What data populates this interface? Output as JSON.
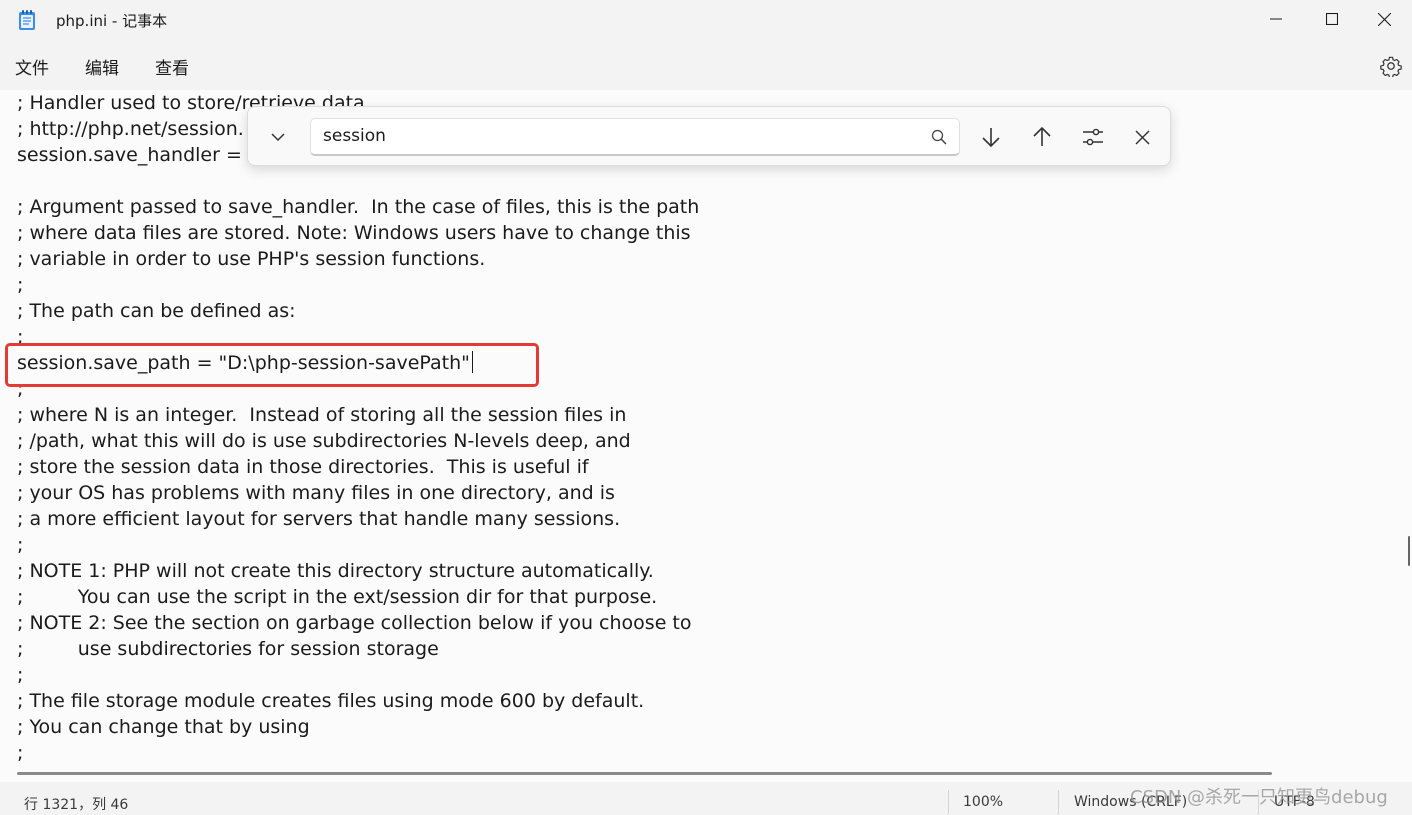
{
  "window": {
    "title": "php.ini - 记事本"
  },
  "menu": {
    "items": [
      "文件",
      "编辑",
      "查看"
    ]
  },
  "editor": {
    "lines": [
      "; Handler used to store/retrieve data.",
      "; http://php.net/session.",
      "session.save_handler = f",
      "",
      "; Argument passed to save_handler.  In the case of files, this is the path",
      "; where data files are stored. Note: Windows users have to change this",
      "; variable in order to use PHP's session functions.",
      ";",
      "; The path can be defined as:",
      ";",
      "session.save_path = \"D:\\php-session-savePath\"",
      ";",
      "; where N is an integer.  Instead of storing all the session files in",
      "; /path, what this will do is use subdirectories N-levels deep, and",
      "; store the session data in those directories.  This is useful if",
      "; your OS has problems with many files in one directory, and is",
      "; a more efficient layout for servers that handle many sessions.",
      ";",
      "; NOTE 1: PHP will not create this directory structure automatically.",
      ";         You can use the script in the ext/session dir for that purpose.",
      "; NOTE 2: See the section on garbage collection below if you choose to",
      ";         use subdirectories for session storage",
      ";",
      "; The file storage module creates files using mode 600 by default.",
      "; You can change that by using",
      ";"
    ]
  },
  "find": {
    "query": "session"
  },
  "status": {
    "position": "行 1321，列 46",
    "zoom": "100%",
    "line_ending": "Windows (CRLF)",
    "encoding": "UTF-8"
  },
  "watermark": "CSDN @杀死一只知更鸟debug",
  "icons": {
    "app": "notepad-icon",
    "settings": "gear-icon",
    "expand": "chevron-down-icon",
    "search": "search-icon",
    "next": "arrow-down-icon",
    "previous": "arrow-up-icon",
    "options": "sliders-icon",
    "close": "close-icon"
  },
  "colors": {
    "highlight_border": "#e53935"
  }
}
